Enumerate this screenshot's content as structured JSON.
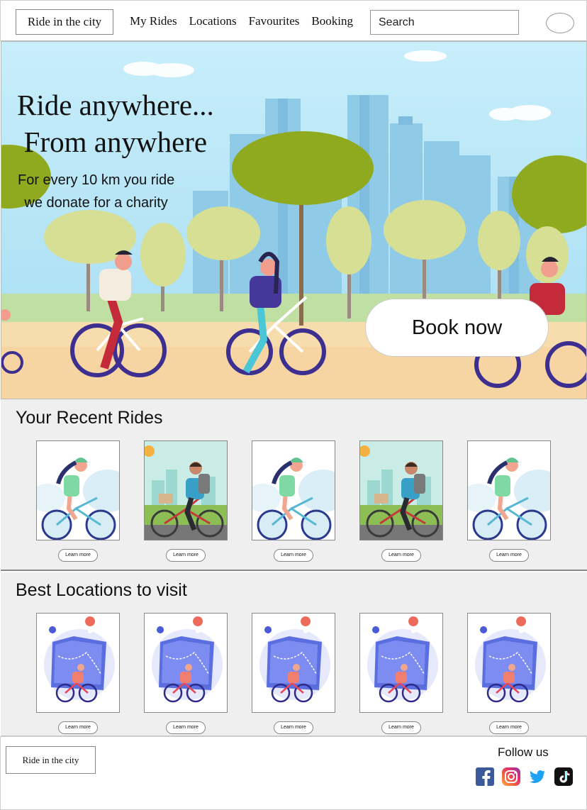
{
  "nav": {
    "logo": "Ride in the city",
    "links": [
      "My Rides",
      "Locations",
      "Favourites",
      "Booking"
    ],
    "search_placeholder": "Search"
  },
  "hero": {
    "title_line1": "Ride anywhere...",
    "title_line2": "From anywhere",
    "subtitle_line1": "For every 10 km you ride",
    "subtitle_line2": "we donate for a charity",
    "cta": "Book now"
  },
  "recent_rides": {
    "title": "Your Recent Rides",
    "cards": [
      {
        "image": "woman-cycling",
        "button": "Learn more"
      },
      {
        "image": "man-cycling-city",
        "button": "Learn more"
      },
      {
        "image": "woman-cycling",
        "button": "Learn more"
      },
      {
        "image": "man-cycling-city",
        "button": "Learn more"
      },
      {
        "image": "woman-cycling",
        "button": "Learn more"
      }
    ]
  },
  "locations": {
    "title": "Best Locations to visit",
    "cards": [
      {
        "image": "cyclist-map",
        "button": "Learn more"
      },
      {
        "image": "cyclist-map",
        "button": "Learn more"
      },
      {
        "image": "cyclist-map",
        "button": "Learn more"
      },
      {
        "image": "cyclist-map",
        "button": "Learn more"
      },
      {
        "image": "cyclist-map",
        "button": "Learn more"
      }
    ]
  },
  "footer": {
    "logo": "Ride in the city",
    "follow_title": "Follow us",
    "social": [
      "facebook-icon",
      "instagram-icon",
      "twitter-icon",
      "tiktok-icon"
    ]
  },
  "colors": {
    "sky": "#b7e6f7",
    "buildings": "#8fcbe6",
    "grass": "#a9d66f",
    "path": "#f6d6a3",
    "section_bg": "#efefef",
    "bike_purple": "#3d2f8f"
  }
}
